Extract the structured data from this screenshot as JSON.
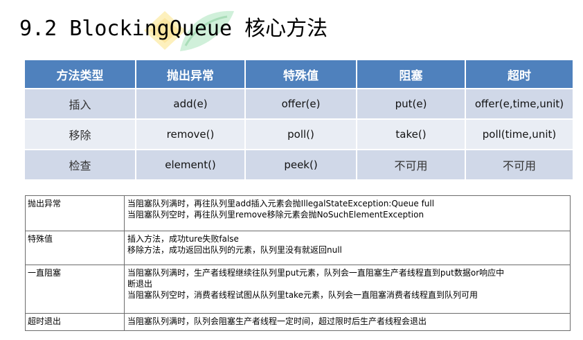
{
  "title": "9.2 BlockingQueue 核心方法",
  "methods_table": {
    "headers": [
      "方法类型",
      "抛出异常",
      "特殊值",
      "阻塞",
      "超时"
    ],
    "rows": [
      {
        "type": "插入",
        "throws": "add(e)",
        "special": "offer(e)",
        "blocks": "put(e)",
        "timeout": "offer(e,time,unit)"
      },
      {
        "type": "移除",
        "throws": "remove()",
        "special": "poll()",
        "blocks": "take()",
        "timeout": "poll(time,unit)"
      },
      {
        "type": "检查",
        "throws": "element()",
        "special": "peek()",
        "blocks": "不可用",
        "timeout": "不可用"
      }
    ]
  },
  "description_table": {
    "rows": [
      {
        "label": "抛出异常",
        "lines": [
          "当阻塞队列满时，再往队列里add插入元素会抛IllegalStateException:Queue full",
          "当阻塞队列空时，再往队列里remove移除元素会抛NoSuchElementException"
        ]
      },
      {
        "label": "特殊值",
        "lines": [
          "插入方法，成功ture失败false",
          "移除方法，成功返回出队列的元素，队列里没有就返回null"
        ]
      },
      {
        "label": "一直阻塞",
        "lines": [
          "当阻塞队列满时，生产者线程继续往队列里put元素，队列会一直阻塞生产者线程直到put数据or响应中",
          "断退出",
          "当阻塞队列空时，消费者线程试图从队列里take元素，队列会一直阻塞消费者线程直到队列可用"
        ]
      },
      {
        "label": "超时退出",
        "lines": [
          "当阻塞队列满时，队列会阻塞生产者线程一定时间，超过限时后生产者线程会退出"
        ]
      }
    ]
  },
  "colors": {
    "header_bg": "#4f81bd",
    "row_dark": "#d0d8e8",
    "row_light": "#e9edf4",
    "watermark_yellow": "#fde9a6",
    "watermark_green": "#c9ead2"
  }
}
